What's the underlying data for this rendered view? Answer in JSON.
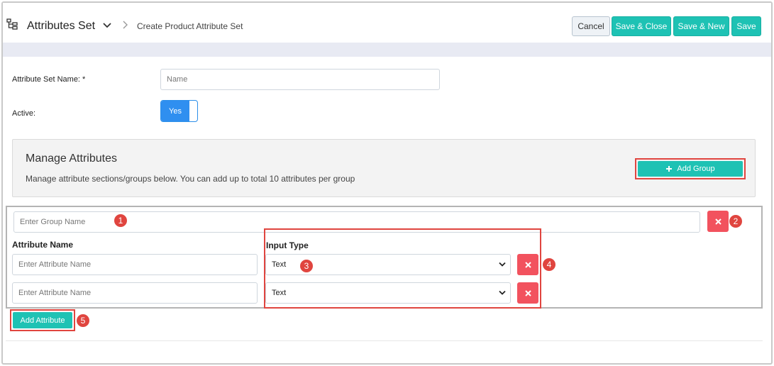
{
  "header": {
    "title": "Attributes Set",
    "breadcrumb": "Create Product Attribute Set",
    "buttons": {
      "cancel": "Cancel",
      "save_close": "Save & Close",
      "save_new": "Save & New",
      "save": "Save"
    }
  },
  "form": {
    "name_label": "Attribute Set Name: *",
    "name_placeholder": "Name",
    "active_label": "Active:",
    "active_value": "Yes"
  },
  "manage": {
    "title": "Manage Attributes",
    "description": "Manage attribute sections/groups below. You can add up to total 10 attributes per group",
    "add_group_label": "Add Group"
  },
  "group": {
    "name_placeholder": "Enter Group Name",
    "attribute_name_header": "Attribute Name",
    "input_type_header": "Input Type",
    "rows": [
      {
        "placeholder": "Enter Attribute Name",
        "input_type": "Text"
      },
      {
        "placeholder": "Enter Attribute Name",
        "input_type": "Text"
      }
    ],
    "add_attribute_label": "Add Attribute"
  },
  "callouts": [
    "1",
    "2",
    "3",
    "4",
    "5"
  ],
  "colors": {
    "teal": "#1ec2b4",
    "danger": "#f2525e",
    "highlight": "#e0453f",
    "toggle_blue": "#2f8ff0"
  },
  "icons": {
    "header": "hierarchy-icon",
    "delete": "x-icon",
    "add": "plus-icon",
    "dropdown": "chevron-down-icon"
  }
}
